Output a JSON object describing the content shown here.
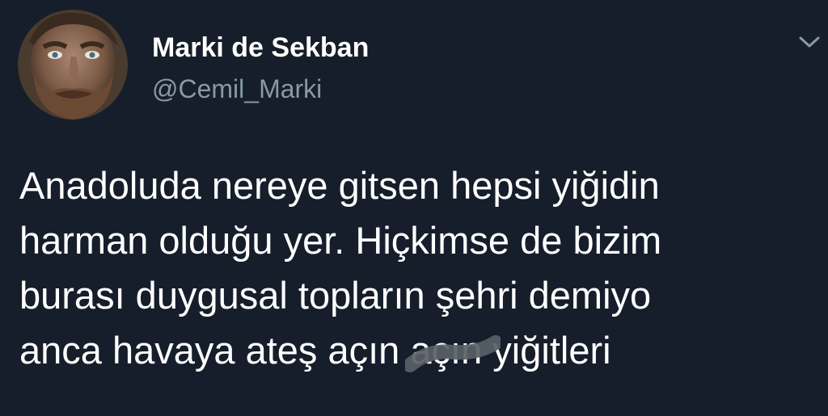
{
  "author": {
    "display_name": "Marki de Sekban",
    "handle": "@Cemil_Marki",
    "avatar_icon": "user-avatar-photo"
  },
  "menu": {
    "icon": "chevron-down-icon"
  },
  "tweet": {
    "lines": [
      "Anadoluda nereye gitsen hepsi yiğidin",
      "harman olduğu yer. Hiçkimse de bizim",
      "burası duygusal topların şehri demiyo"
    ],
    "last_line_before": "anca havaya ateş açın ",
    "scribbled_word": "açın",
    "last_line_after": " yiğitleri"
  },
  "colors": {
    "background": "#151e2a",
    "text_primary": "#ffffff",
    "text_secondary": "#8899a6",
    "scribble": "#5a5f66"
  }
}
